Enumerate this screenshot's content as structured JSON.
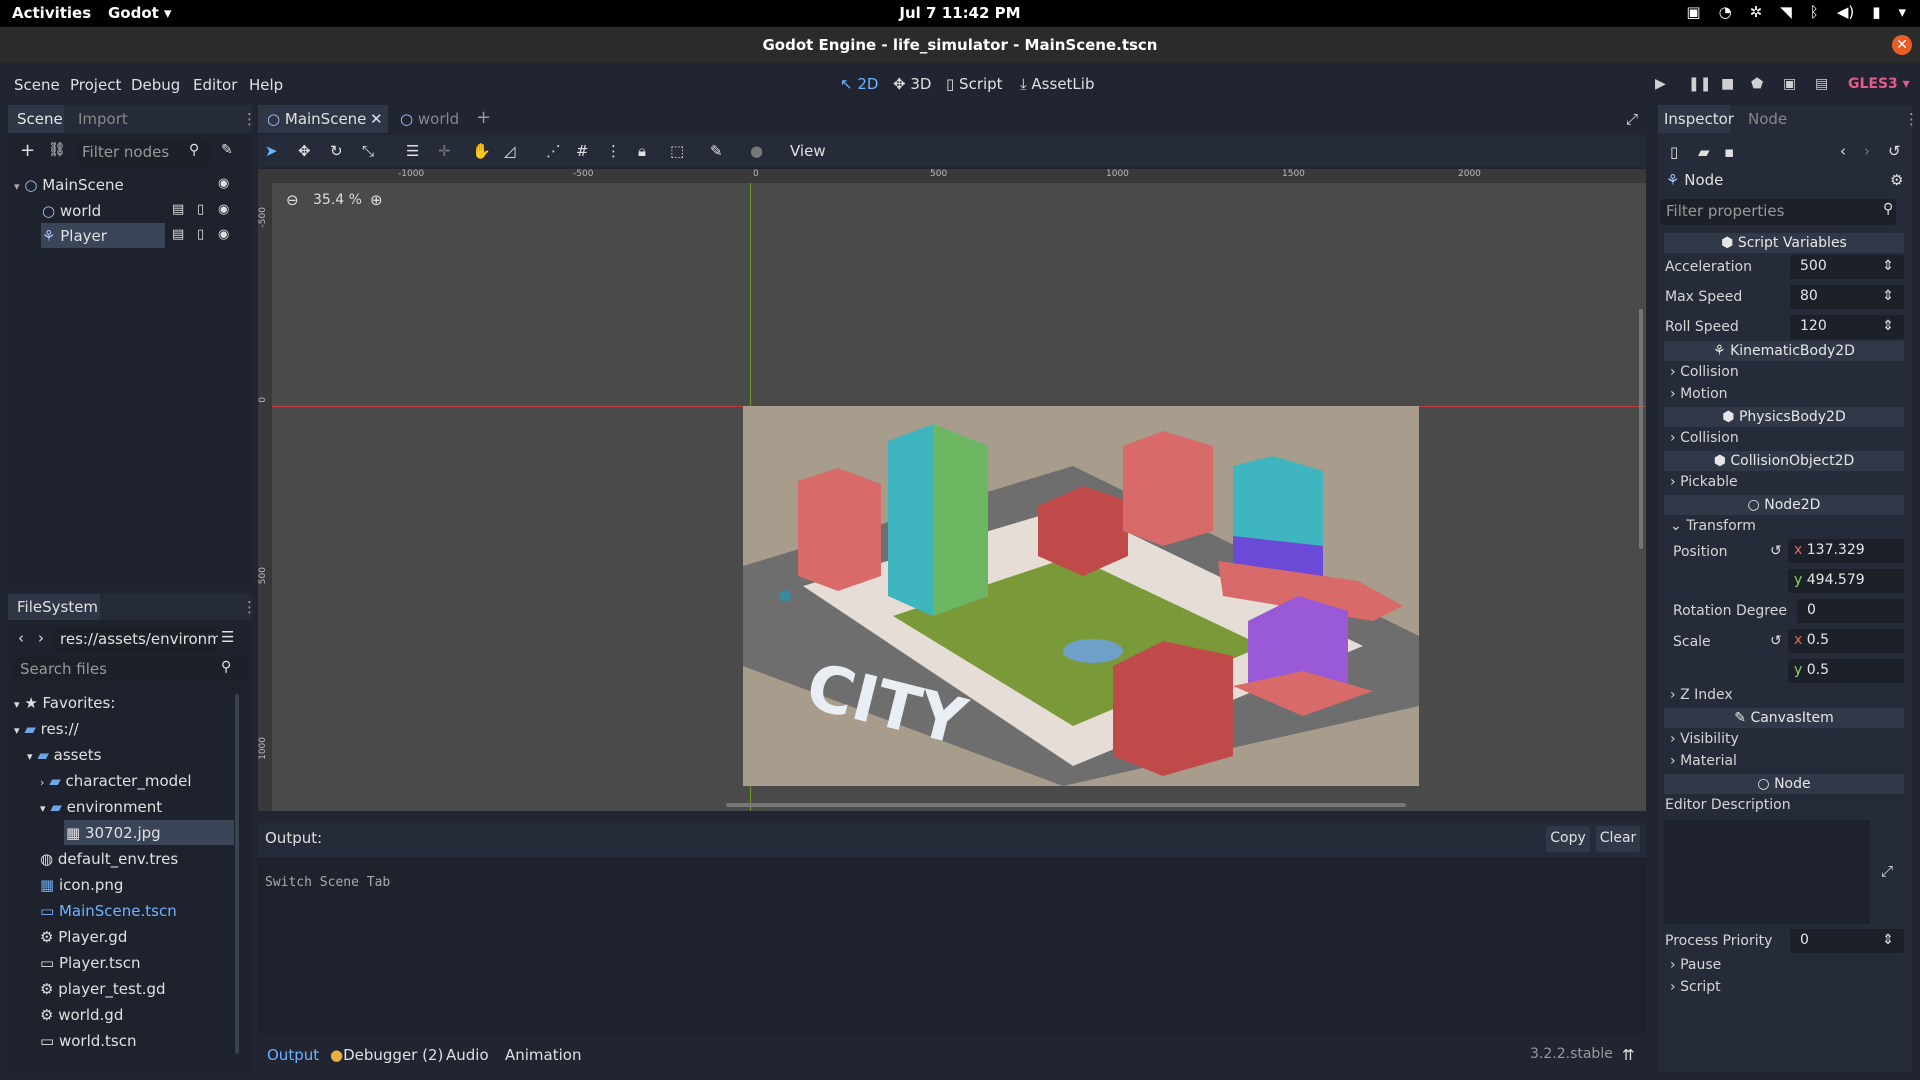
{
  "gnome": {
    "activities": "Activities",
    "app": "Godot ▾",
    "clock": "Jul 7  11:42 PM"
  },
  "window": {
    "title": "Godot Engine - life_simulator - MainScene.tscn"
  },
  "menus": [
    "Scene",
    "Project",
    "Debug",
    "Editor",
    "Help"
  ],
  "workspaces": [
    {
      "label": "2D",
      "icon": "↖"
    },
    {
      "label": "3D",
      "icon": "✥"
    },
    {
      "label": "Script",
      "icon": "▯"
    },
    {
      "label": "AssetLib",
      "icon": "⤓"
    }
  ],
  "renderer": "GLES3",
  "scene_dock": {
    "tabs": [
      "Scene",
      "Import"
    ],
    "filter_placeholder": "Filter nodes",
    "nodes": [
      {
        "label": "MainScene"
      },
      {
        "label": "world"
      },
      {
        "label": "Player"
      }
    ]
  },
  "filesystem": {
    "tab": "FileSystem",
    "path": "res://assets/environm",
    "search_placeholder": "Search files",
    "items": [
      {
        "label": "Favorites:",
        "icon": "★"
      },
      {
        "label": "res://",
        "icon": "▰"
      },
      {
        "label": "assets",
        "icon": "▰"
      },
      {
        "label": "character_model",
        "icon": "▰"
      },
      {
        "label": "environment",
        "icon": "▰"
      },
      {
        "label": "30702.jpg",
        "icon": "▦"
      },
      {
        "label": "default_env.tres",
        "icon": "◍"
      },
      {
        "label": "icon.png",
        "icon": "▦"
      },
      {
        "label": "MainScene.tscn",
        "icon": "▭"
      },
      {
        "label": "Player.gd",
        "icon": "⚙"
      },
      {
        "label": "Player.tscn",
        "icon": "▭"
      },
      {
        "label": "player_test.gd",
        "icon": "⚙"
      },
      {
        "label": "world.gd",
        "icon": "⚙"
      },
      {
        "label": "world.tscn",
        "icon": "▭"
      }
    ]
  },
  "scene_tabs": [
    "MainScene",
    "world"
  ],
  "viewport": {
    "zoom": "35.4 %",
    "view_menu": "View",
    "ruler": [
      "-1000",
      "-500",
      "0",
      "500",
      "1000",
      "1500",
      "2000"
    ],
    "vruler": [
      "-500",
      "0",
      "500",
      "1000"
    ],
    "image_text": "CITY"
  },
  "output": {
    "label": "Output:",
    "copy": "Copy",
    "clear": "Clear",
    "text": "Switch Scene Tab",
    "bottom_tabs": [
      "Output",
      "Debugger (2)",
      "Audio",
      "Animation"
    ],
    "version": "3.2.2.stable"
  },
  "inspector": {
    "tabs": [
      "Inspector",
      "Node"
    ],
    "node": "Node",
    "filter_placeholder": "Filter properties",
    "script_vars": "Script Variables",
    "vars": [
      {
        "name": "Acceleration",
        "value": "500"
      },
      {
        "name": "Max Speed",
        "value": "80"
      },
      {
        "name": "Roll Speed",
        "value": "120"
      }
    ],
    "kinematic": "KinematicBody2D",
    "collision": "Collision",
    "motion": "Motion",
    "physics": "PhysicsBody2D",
    "collision2": "Collision",
    "colobj": "CollisionObject2D",
    "pickable": "Pickable",
    "node2d": "Node2D",
    "transform": "Transform",
    "position": "Position",
    "pos_x": "137.329",
    "pos_y": "494.579",
    "rotation": "Rotation Degree",
    "rotation_val": "0",
    "scale": "Scale",
    "scale_x": "0.5",
    "scale_y": "0.5",
    "zindex": "Z Index",
    "canvasitem": "CanvasItem",
    "visibility": "Visibility",
    "material": "Material",
    "editor_desc": "Editor Description",
    "priority": "Process Priority",
    "priority_val": "0",
    "pause": "Pause",
    "script": "Script"
  }
}
